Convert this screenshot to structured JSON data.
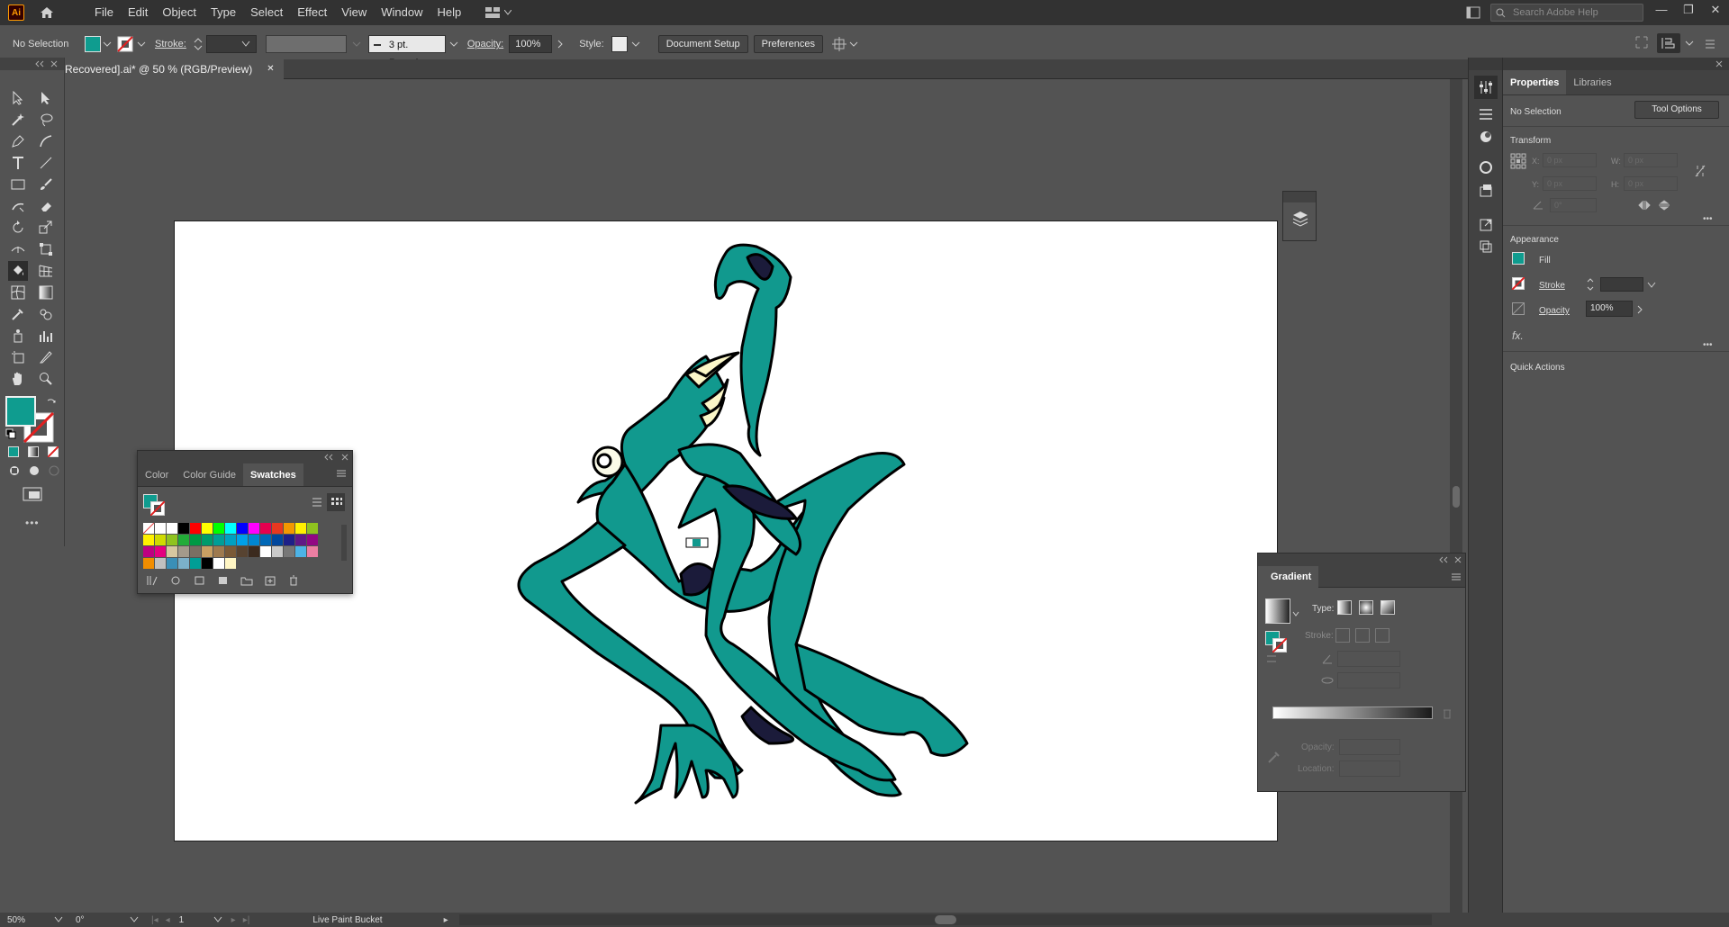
{
  "app": {
    "logo_text": "Ai",
    "menus": [
      "File",
      "Edit",
      "Object",
      "Type",
      "Select",
      "Effect",
      "View",
      "Window",
      "Help"
    ],
    "search_placeholder": "Search Adobe Help",
    "window_controls": [
      "—",
      "❐",
      "✕"
    ]
  },
  "control_bar": {
    "selection": "No Selection",
    "stroke_label": "Stroke:",
    "brush": "3 pt. Round",
    "opacity_label": "Opacity:",
    "opacity_value": "100%",
    "style_label": "Style:",
    "document_setup": "Document Setup",
    "preferences": "Preferences"
  },
  "document_tab": {
    "title": "Recovered].ai* @ 50 % (RGB/Preview)",
    "close": "✕"
  },
  "swatches_panel": {
    "tabs": [
      "Color",
      "Color Guide",
      "Swatches"
    ],
    "active_tab": "Swatches",
    "swatch_colors": [
      "#ffffff",
      "#ffffff",
      "#ffffff",
      "#000000",
      "#ff0000",
      "#ffff00",
      "#00ff00",
      "#00ffff",
      "#0000ff",
      "#ff00ff",
      "#e5004f",
      "#e83820",
      "#f39800",
      "#fff100",
      "#8fc31f",
      "#fff100",
      "#cfdb00",
      "#8fc31f",
      "#22ac38",
      "#009944",
      "#009b6b",
      "#009e96",
      "#00a0c1",
      "#00a0e9",
      "#0086d1",
      "#0068b7",
      "#00479d",
      "#1d2088",
      "#601986",
      "#920783",
      "#be0081",
      "#e4007f",
      "#d7c7a0",
      "#a49a8b",
      "#7b6f63",
      "#c8a063",
      "#9e7a4f",
      "#7a5a37",
      "#574331",
      "#3b2a1e",
      "#ffffff",
      "#c9c9c9",
      "#777777",
      "#4db3e6",
      "#ec7ea2",
      "#f18d00",
      "#c0c0c0",
      "#3a8fb7",
      "#7bb0c9",
      "#009e96",
      "#000000",
      "#ffffff",
      "#fff6c4"
    ]
  },
  "gradient_panel": {
    "title": "Gradient",
    "type_label": "Type:",
    "stroke_label": "Stroke:",
    "opacity_label": "Opacity:",
    "location_label": "Location:"
  },
  "properties_panel": {
    "tabs": [
      "Properties",
      "Libraries"
    ],
    "no_selection": "No Selection",
    "tool_options": "Tool Options",
    "transform_title": "Transform",
    "x_label": "X:",
    "y_label": "Y:",
    "w_label": "W:",
    "h_label": "H:",
    "x_value": "0 px",
    "y_value": "0 px",
    "w_value": "0 px",
    "h_value": "0 px",
    "angle_value": "0°",
    "appearance_title": "Appearance",
    "fill_label": "Fill",
    "stroke_label": "Stroke",
    "opacity_label": "Opacity",
    "opacity_value": "100%",
    "fx_label": "fx.",
    "quick_actions": "Quick Actions",
    "more": "•••"
  },
  "status_bar": {
    "zoom": "50%",
    "rotation": "0°",
    "artboard_num": "1",
    "tool_name": "Live Paint Bucket"
  },
  "colors": {
    "fill": "#0f9c8f",
    "figure": "#11998e",
    "shadow": "#1b1b3a",
    "claws": "#fbf7c8"
  }
}
